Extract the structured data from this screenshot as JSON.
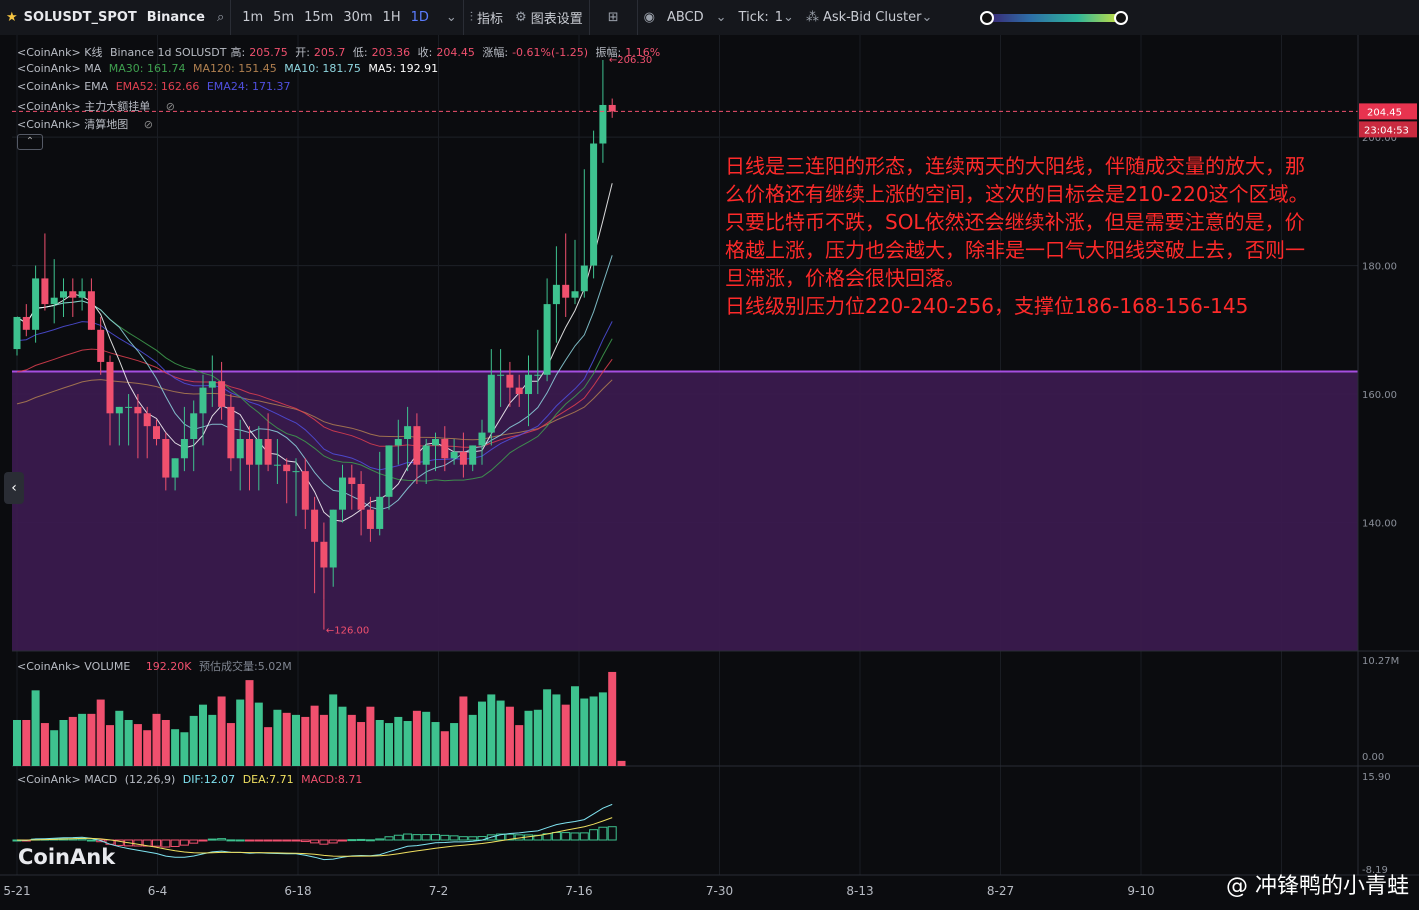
{
  "toolbar": {
    "symbol": "SOLUSDT_SPOT",
    "exchange": "Binance",
    "intervals": [
      "1m",
      "5m",
      "15m",
      "30m",
      "1H",
      "1D"
    ],
    "active_interval": "1D",
    "indicators_label": "指标",
    "chart_settings_label": "图表设置",
    "abcd_label": "ABCD",
    "tick_label": "Tick:",
    "tick_value": "1",
    "cluster_label": "Ask-Bid Cluster"
  },
  "legend": {
    "kline": {
      "prefix": "<CoinAnk> K线",
      "text": "Binance 1d SOLUSDT",
      "high_label": "高:",
      "high": "205.75",
      "open_label": "开:",
      "open": "205.7",
      "low_label": "低:",
      "low": "203.36",
      "close_label": "收:",
      "close": "204.45",
      "change_label": "涨幅:",
      "change": "-0.61%(-1.25)",
      "amp_label": "振幅:",
      "amp": "1.16%"
    },
    "ma": {
      "prefix": "<CoinAnk> MA",
      "ma30": "MA30: 161.74",
      "ma120": "MA120: 151.45",
      "ma10": "MA10: 181.75",
      "ma5": "MA5: 192.91"
    },
    "ema": {
      "prefix": "<CoinAnk> EMA",
      "ema52": "EMA52: 162.66",
      "ema24": "EMA24: 171.37"
    },
    "big_orders": "<CoinAnk> 主力大额挂单",
    "liq_map": "<CoinAnk> 清算地图",
    "volume": {
      "prefix": "<CoinAnk> VOLUME",
      "value": "192.20K",
      "estimate": "预估成交量:5.02M"
    },
    "macd": {
      "prefix": "<CoinAnk> MACD",
      "params": "(12,26,9)",
      "dif": "DIF:12.07",
      "dea": "DEA:7.71",
      "macd": "MACD:8.71"
    }
  },
  "annotation": [
    "日线是三连阳的形态，连续两天的大阳线，伴随成交量的放大，那",
    "么价格还有继续上涨的空间，这次的目标会是210-220这个区域。",
    "只要比特币不跌，SOL依然还会继续补涨，但是需要注意的是，价",
    "格越上涨，压力也会越大，除非是一口气大阳线突破上去，否则一",
    "旦滞涨，价格会很快回落。",
    "日线级别压力位220-240-256，支撑位186-168-156-145"
  ],
  "footer": {
    "logo": "CoinAnk",
    "watermark": "@ 冲锋鸭的小青蛙"
  },
  "colors": {
    "up": "#3ec28f",
    "down": "#f0506e",
    "zone": "#3a1a4e",
    "zone_line": "#a64ee0",
    "ma5": "#ffffff",
    "ma10": "#8fd6e0",
    "ema24": "#5050e0",
    "ema52": "#e04050",
    "ma30": "#3fa04f",
    "ma120": "#b08050",
    "dif": "#7fe3f0",
    "dea": "#f0e060"
  },
  "chart_data": {
    "type": "candlestick",
    "x_ticks": [
      "5-21",
      "6-4",
      "6-18",
      "7-2",
      "7-16",
      "7-30",
      "8-13",
      "8-27",
      "9-10"
    ],
    "y_ticks": [
      140,
      160,
      180,
      200
    ],
    "ylim": [
      120,
      212
    ],
    "price_tag": "204.45",
    "countdown": "23:04:53",
    "high_marker": "206.30",
    "low_marker": "126.00",
    "zone": [
      120,
      163.5
    ],
    "volume_axis": [
      "10.27M",
      "0.00"
    ],
    "macd_axis": [
      "15.90",
      "-8.19"
    ],
    "candles": [
      [
        167,
        172,
        166,
        172
      ],
      [
        172,
        174,
        169,
        170
      ],
      [
        170,
        180,
        168,
        178
      ],
      [
        178,
        185,
        173,
        174
      ],
      [
        174,
        181,
        171,
        175
      ],
      [
        175,
        178,
        172,
        176
      ],
      [
        176,
        178,
        172,
        175
      ],
      [
        175,
        178,
        173,
        176
      ],
      [
        176,
        178,
        170,
        170
      ],
      [
        170,
        172,
        163,
        165
      ],
      [
        165,
        166,
        152,
        157
      ],
      [
        157,
        158,
        152,
        158
      ],
      [
        158,
        160,
        152,
        158
      ],
      [
        158,
        160,
        150,
        157
      ],
      [
        157,
        158,
        150,
        155
      ],
      [
        155,
        156,
        152,
        153
      ],
      [
        153,
        154,
        145,
        147
      ],
      [
        147,
        150,
        145,
        150
      ],
      [
        150,
        158,
        148,
        153
      ],
      [
        153,
        159,
        148,
        157
      ],
      [
        157,
        163,
        152,
        161
      ],
      [
        161,
        166,
        158,
        162
      ],
      [
        162,
        165,
        156,
        158
      ],
      [
        158,
        160,
        148,
        150
      ],
      [
        150,
        156,
        145,
        153
      ],
      [
        153,
        155,
        145,
        149
      ],
      [
        149,
        155,
        145,
        153
      ],
      [
        153,
        157,
        148,
        149
      ],
      [
        149,
        153,
        146,
        149
      ],
      [
        149,
        150,
        143,
        148
      ],
      [
        148,
        150,
        141,
        148
      ],
      [
        148,
        150,
        139,
        142
      ],
      [
        142,
        144,
        129,
        137
      ],
      [
        137,
        140,
        128,
        133
      ],
      [
        133,
        142,
        130,
        142
      ],
      [
        142,
        149,
        140,
        147
      ],
      [
        147,
        149,
        142,
        146
      ],
      [
        146,
        148,
        138,
        142
      ],
      [
        142,
        144,
        137,
        139
      ],
      [
        139,
        151,
        138,
        144
      ],
      [
        144,
        152,
        142,
        152
      ],
      [
        152,
        156,
        149,
        153
      ],
      [
        153,
        158,
        148,
        155
      ],
      [
        155,
        157,
        146,
        149
      ],
      [
        149,
        153,
        146,
        152
      ],
      [
        152,
        154,
        148,
        153
      ],
      [
        153,
        155,
        148,
        150
      ],
      [
        150,
        153,
        149,
        151
      ],
      [
        151,
        154,
        147,
        149
      ],
      [
        149,
        152,
        148,
        152
      ],
      [
        152,
        156,
        149,
        154
      ],
      [
        154,
        167,
        152,
        163
      ],
      [
        163,
        167,
        158,
        163
      ],
      [
        163,
        165,
        158,
        161
      ],
      [
        161,
        163,
        158,
        160
      ],
      [
        160,
        166,
        155,
        163
      ],
      [
        163,
        170,
        160,
        163
      ],
      [
        163,
        178,
        162,
        174
      ],
      [
        174,
        183,
        168,
        177
      ],
      [
        177,
        185,
        172,
        175
      ],
      [
        175,
        184,
        174,
        176
      ],
      [
        176,
        195,
        175,
        180
      ],
      [
        180,
        201,
        178,
        199
      ],
      [
        199,
        212,
        196,
        205
      ],
      [
        205,
        206,
        203,
        204
      ]
    ],
    "volume": [
      4.5,
      4.5,
      7.4,
      4.2,
      3.5,
      4.5,
      4.8,
      5.1,
      5.1,
      6.5,
      4.0,
      5.4,
      4.5,
      4.1,
      3.5,
      5.1,
      4.5,
      3.6,
      3.3,
      4.9,
      6.0,
      5.0,
      6.8,
      4.2,
      6.5,
      8.4,
      6.2,
      3.8,
      5.5,
      5.2,
      5.0,
      4.8,
      5.9,
      5.0,
      7.0,
      5.8,
      5.0,
      4.3,
      5.8,
      4.5,
      4.2,
      4.8,
      4.4,
      5.4,
      5.3,
      4.3,
      3.4,
      4.2,
      6.8,
      5.0,
      6.3,
      7.0,
      6.4,
      5.8,
      4.0,
      5.4,
      5.5,
      7.5,
      7.0,
      6.0,
      7.8,
      6.6,
      6.8,
      7.2,
      9.2,
      0.5
    ]
  }
}
